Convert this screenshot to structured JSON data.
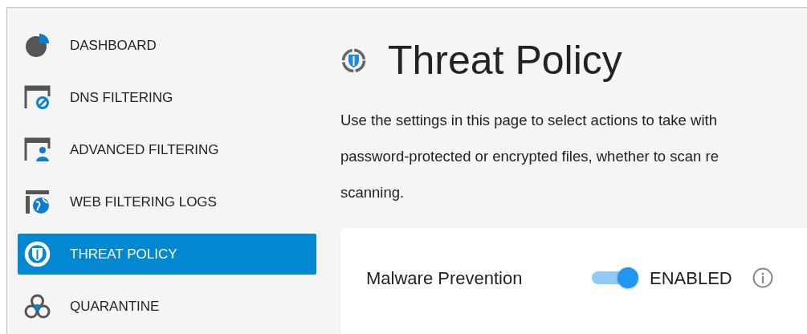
{
  "sidebar": {
    "items": [
      {
        "label": "DASHBOARD",
        "selected": false
      },
      {
        "label": "DNS FILTERING",
        "selected": false
      },
      {
        "label": "ADVANCED FILTERING",
        "selected": false
      },
      {
        "label": "WEB FILTERING LOGS",
        "selected": false
      },
      {
        "label": "THREAT POLICY",
        "selected": true
      },
      {
        "label": "QUARANTINE",
        "selected": false
      }
    ]
  },
  "page": {
    "title": "Threat Policy",
    "description_lines": [
      "Use the settings in this page to select actions to take with",
      "password-protected or encrypted files, whether to scan re",
      "scanning."
    ]
  },
  "settings": [
    {
      "label": "Malware Prevention",
      "on": true,
      "status": "ENABLED"
    }
  ]
}
